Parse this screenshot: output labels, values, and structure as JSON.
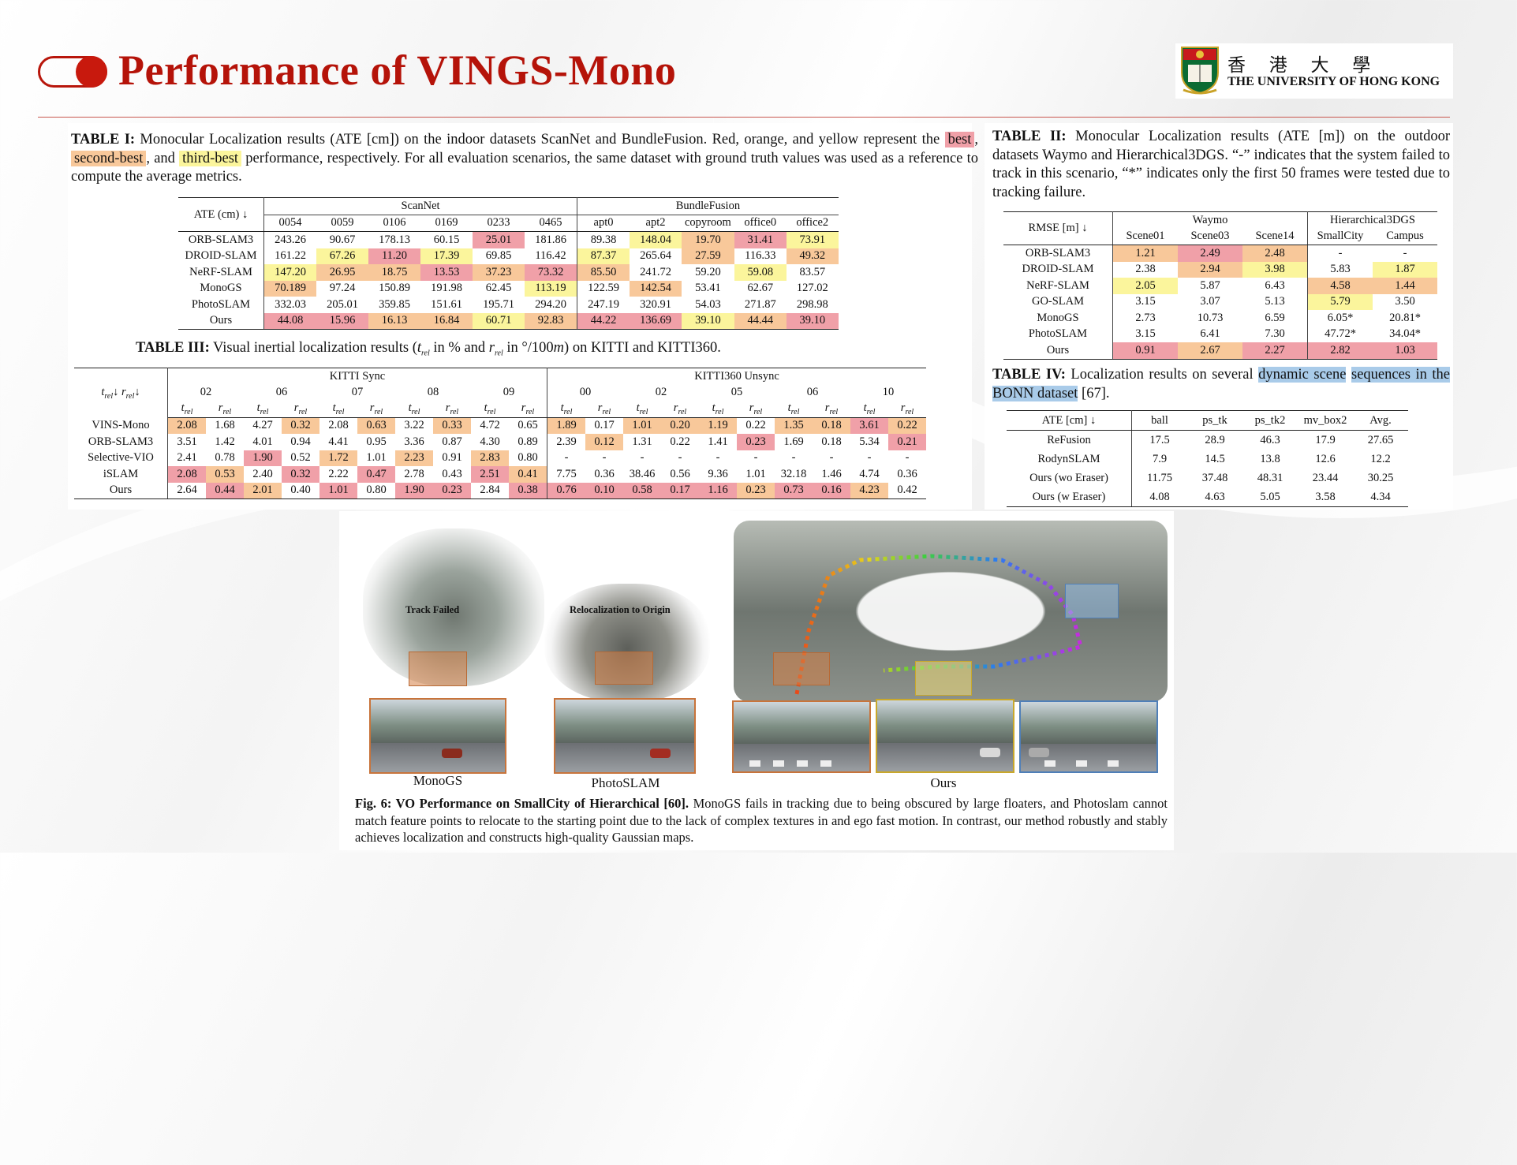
{
  "page": {
    "title": "Performance of VINGS-Mono",
    "logo_cn": "香 港 大 學",
    "logo_en": "THE UNIVERSITY OF HONG KONG"
  },
  "table1": {
    "cap_label": "TABLE I:",
    "cap_a": "Monocular Localization results (ATE [cm]) on the indoor datasets ScanNet and BundleFusion. Red, orange, and yellow represent the",
    "best": "best",
    "second": "second-best",
    "third": "third-best",
    "cap_b": "performance, respectively. For all evaluation scenarios, the same dataset with ground truth values was used as a reference to compute the average metrics.",
    "corner": "ATE (cm) ↓",
    "group1": "ScanNet",
    "group2": "BundleFusion",
    "cols": [
      "0054",
      "0059",
      "0106",
      "0169",
      "0233",
      "0465",
      "apt0",
      "apt2",
      "copyroom",
      "office0",
      "office2"
    ],
    "rows": [
      {
        "name": "ORB-SLAM3",
        "v": [
          "243.26",
          "90.67",
          "178.13",
          "60.15",
          "25.01",
          "181.86",
          "89.38",
          "148.04",
          "19.70",
          "31.41",
          "73.91"
        ],
        "c": [
          "",
          "",
          "",
          "",
          "r",
          "",
          "",
          "y",
          "o",
          "r",
          "y"
        ]
      },
      {
        "name": "DROID-SLAM",
        "v": [
          "161.22",
          "67.26",
          "11.20",
          "17.39",
          "69.85",
          "116.42",
          "87.37",
          "265.64",
          "27.59",
          "116.33",
          "49.32"
        ],
        "c": [
          "",
          "y",
          "r",
          "y",
          "",
          "",
          "y",
          "",
          "o",
          "",
          "o"
        ]
      },
      {
        "name": "NeRF-SLAM",
        "v": [
          "147.20",
          "26.95",
          "18.75",
          "13.53",
          "37.23",
          "73.32",
          "85.50",
          "241.72",
          "59.20",
          "59.08",
          "83.57"
        ],
        "c": [
          "y",
          "o",
          "o",
          "r",
          "o",
          "r",
          "o",
          "",
          "",
          "y",
          ""
        ]
      },
      {
        "name": "MonoGS",
        "v": [
          "70.189",
          "97.24",
          "150.89",
          "191.98",
          "62.45",
          "113.19",
          "122.59",
          "142.54",
          "53.41",
          "62.67",
          "127.02"
        ],
        "c": [
          "o",
          "",
          "",
          "",
          "",
          "y",
          "",
          "o",
          "",
          "",
          ""
        ]
      },
      {
        "name": "PhotoSLAM",
        "v": [
          "332.03",
          "205.01",
          "359.85",
          "151.61",
          "195.71",
          "294.20",
          "247.19",
          "320.91",
          "54.03",
          "271.87",
          "298.98"
        ],
        "c": [
          "",
          "",
          "",
          "",
          "",
          "",
          "",
          "",
          "",
          "",
          ""
        ]
      },
      {
        "name": "Ours",
        "v": [
          "44.08",
          "15.96",
          "16.13",
          "16.84",
          "60.71",
          "92.83",
          "44.22",
          "136.69",
          "39.10",
          "44.44",
          "39.10"
        ],
        "c": [
          "r",
          "r",
          "o",
          "o",
          "y",
          "o",
          "r",
          "r",
          "y",
          "o",
          "r"
        ]
      }
    ]
  },
  "table3": {
    "cap_label": "TABLE III:",
    "cap_text": "Visual inertial localization results (t",
    "cap_sub1": "rel",
    "cap_mid": " in % and r",
    "cap_sub2": "rel",
    "cap_end": " in °/100m) on KITTI and KITTI360.",
    "corner": "t_rel↓ r_rel↓",
    "group1": "KITTI Sync",
    "group2": "KITTI360 Unsync",
    "seqs": [
      "02",
      "06",
      "07",
      "08",
      "09",
      "00",
      "02",
      "05",
      "06",
      "10"
    ],
    "rows": [
      {
        "name": "VINS-Mono",
        "v": [
          "2.08",
          "1.68",
          "4.27",
          "0.32",
          "2.08",
          "0.63",
          "3.22",
          "0.33",
          "4.72",
          "0.65",
          "1.89",
          "0.17",
          "1.01",
          "0.20",
          "1.19",
          "0.22",
          "1.35",
          "0.18",
          "3.61",
          "0.22"
        ],
        "c": [
          "o",
          "",
          "",
          "o",
          "",
          "o",
          "",
          "o",
          "",
          "",
          "o",
          "",
          "o",
          "o",
          "o",
          "",
          "o",
          "o",
          "r",
          "o"
        ]
      },
      {
        "name": "ORB-SLAM3",
        "v": [
          "3.51",
          "1.42",
          "4.01",
          "0.94",
          "4.41",
          "0.95",
          "3.36",
          "0.87",
          "4.30",
          "0.89",
          "2.39",
          "0.12",
          "1.31",
          "0.22",
          "1.41",
          "0.23",
          "1.69",
          "0.18",
          "5.34",
          "0.21"
        ],
        "c": [
          "",
          "",
          "",
          "",
          "",
          "",
          "",
          "",
          "",
          "",
          "",
          "o",
          "",
          "",
          "",
          "r",
          "",
          "",
          "",
          "r"
        ]
      },
      {
        "name": "Selective-VIO",
        "v": [
          "2.41",
          "0.78",
          "1.90",
          "0.52",
          "1.72",
          "1.01",
          "2.23",
          "0.91",
          "2.83",
          "0.80",
          "-",
          "-",
          "-",
          "-",
          "-",
          "-",
          "-",
          "-",
          "-",
          "-"
        ],
        "c": [
          "",
          "",
          "r",
          "",
          "o",
          "",
          "o",
          "",
          "o",
          "",
          "",
          "",
          "",
          "",
          "",
          "",
          "",
          "",
          "",
          ""
        ]
      },
      {
        "name": "iSLAM",
        "v": [
          "2.08",
          "0.53",
          "2.40",
          "0.32",
          "2.22",
          "0.47",
          "2.78",
          "0.43",
          "2.51",
          "0.41",
          "7.75",
          "0.36",
          "38.46",
          "0.56",
          "9.36",
          "1.01",
          "32.18",
          "1.46",
          "4.74",
          "0.36"
        ],
        "c": [
          "r",
          "o",
          "",
          "r",
          "",
          "r",
          "",
          "",
          "r",
          "o",
          "",
          "",
          "",
          "",
          "",
          "",
          "",
          "",
          "",
          ""
        ]
      },
      {
        "name": "Ours",
        "v": [
          "2.64",
          "0.44",
          "2.01",
          "0.40",
          "1.01",
          "0.80",
          "1.90",
          "0.23",
          "2.84",
          "0.38",
          "0.76",
          "0.10",
          "0.58",
          "0.17",
          "1.16",
          "0.23",
          "0.73",
          "0.16",
          "4.23",
          "0.42"
        ],
        "c": [
          "",
          "r",
          "o",
          "",
          "r",
          "",
          "r",
          "r",
          "",
          "r",
          "r",
          "r",
          "r",
          "r",
          "r",
          "o",
          "r",
          "r",
          "o",
          ""
        ]
      }
    ]
  },
  "table2": {
    "cap_label": "TABLE II:",
    "cap_text": "Monocular Localization results (ATE [m]) on the outdoor datasets Waymo and Hierarchical3DGS. “-” indicates that the system failed to track in this scenario, “*” indicates only the first 50 frames were tested due to tracking failure.",
    "corner": "RMSE [m] ↓",
    "group1": "Waymo",
    "group2": "Hierarchical3DGS",
    "cols": [
      "Scene01",
      "Scene03",
      "Scene14",
      "SmallCity",
      "Campus"
    ],
    "rows": [
      {
        "name": "ORB-SLAM3",
        "v": [
          "1.21",
          "2.49",
          "2.48",
          "-",
          "-"
        ],
        "c": [
          "o",
          "r",
          "o",
          "",
          ""
        ]
      },
      {
        "name": "DROID-SLAM",
        "v": [
          "2.38",
          "2.94",
          "3.98",
          "5.83",
          "1.87"
        ],
        "c": [
          "",
          "o",
          "y",
          "",
          "y"
        ]
      },
      {
        "name": "NeRF-SLAM",
        "v": [
          "2.05",
          "5.87",
          "6.43",
          "4.58",
          "1.44"
        ],
        "c": [
          "y",
          "",
          "",
          "o",
          "o"
        ]
      },
      {
        "name": "GO-SLAM",
        "v": [
          "3.15",
          "3.07",
          "5.13",
          "5.79",
          "3.50"
        ],
        "c": [
          "",
          "",
          "",
          "y",
          ""
        ]
      },
      {
        "name": "MonoGS",
        "v": [
          "2.73",
          "10.73",
          "6.59",
          "6.05*",
          "20.81*"
        ],
        "c": [
          "",
          "",
          "",
          "",
          ""
        ]
      },
      {
        "name": "PhotoSLAM",
        "v": [
          "3.15",
          "6.41",
          "7.30",
          "47.72*",
          "34.04*"
        ],
        "c": [
          "",
          "",
          "",
          "",
          ""
        ]
      },
      {
        "name": "Ours",
        "v": [
          "0.91",
          "2.67",
          "2.27",
          "2.82",
          "1.03"
        ],
        "c": [
          "r",
          "o",
          "r",
          "r",
          "r"
        ]
      }
    ]
  },
  "table4": {
    "cap_label": "TABLE IV:",
    "cap_a": "Localization results on several",
    "cap_hl1": "dynamic scene",
    "cap_hl2": "sequences in the BONN dataset",
    "cap_b": "[67].",
    "cols": [
      "ATE [cm] ↓",
      "ball",
      "ps_tk",
      "ps_tk2",
      "mv_box2",
      "Avg."
    ],
    "rows": [
      {
        "name": "ReFusion",
        "v": [
          "17.5",
          "28.9",
          "46.3",
          "17.9",
          "27.65"
        ]
      },
      {
        "name": "RodynSLAM",
        "v": [
          "7.9",
          "14.5",
          "13.8",
          "12.6",
          "12.2"
        ]
      },
      {
        "name": "Ours (wo Eraser)",
        "v": [
          "11.75",
          "37.48",
          "48.31",
          "23.44",
          "30.25"
        ]
      },
      {
        "name": "Ours (w Eraser)",
        "v": [
          "4.08",
          "4.63",
          "5.05",
          "3.58",
          "4.34"
        ]
      }
    ]
  },
  "figure": {
    "note1": "Track Failed",
    "note2": "Relocalization to Origin",
    "label1": "MonoGS",
    "label2": "PhotoSLAM",
    "label3": "Ours",
    "cap_label": "Fig. 6: VO Performance on SmallCity of Hierarchical [60].",
    "cap_text": "MonoGS fails in tracking due to being obscured by large floaters, and Photoslam cannot match feature points to relocate to the starting point due to the lack of complex textures in and ego fast motion. In contrast, our method robustly and stably achieves localization and constructs high-quality Gaussian maps."
  },
  "colors": {
    "best": "#f0a0a8",
    "second": "#f8c89a",
    "third": "#fbf59c",
    "title": "#b51309"
  }
}
